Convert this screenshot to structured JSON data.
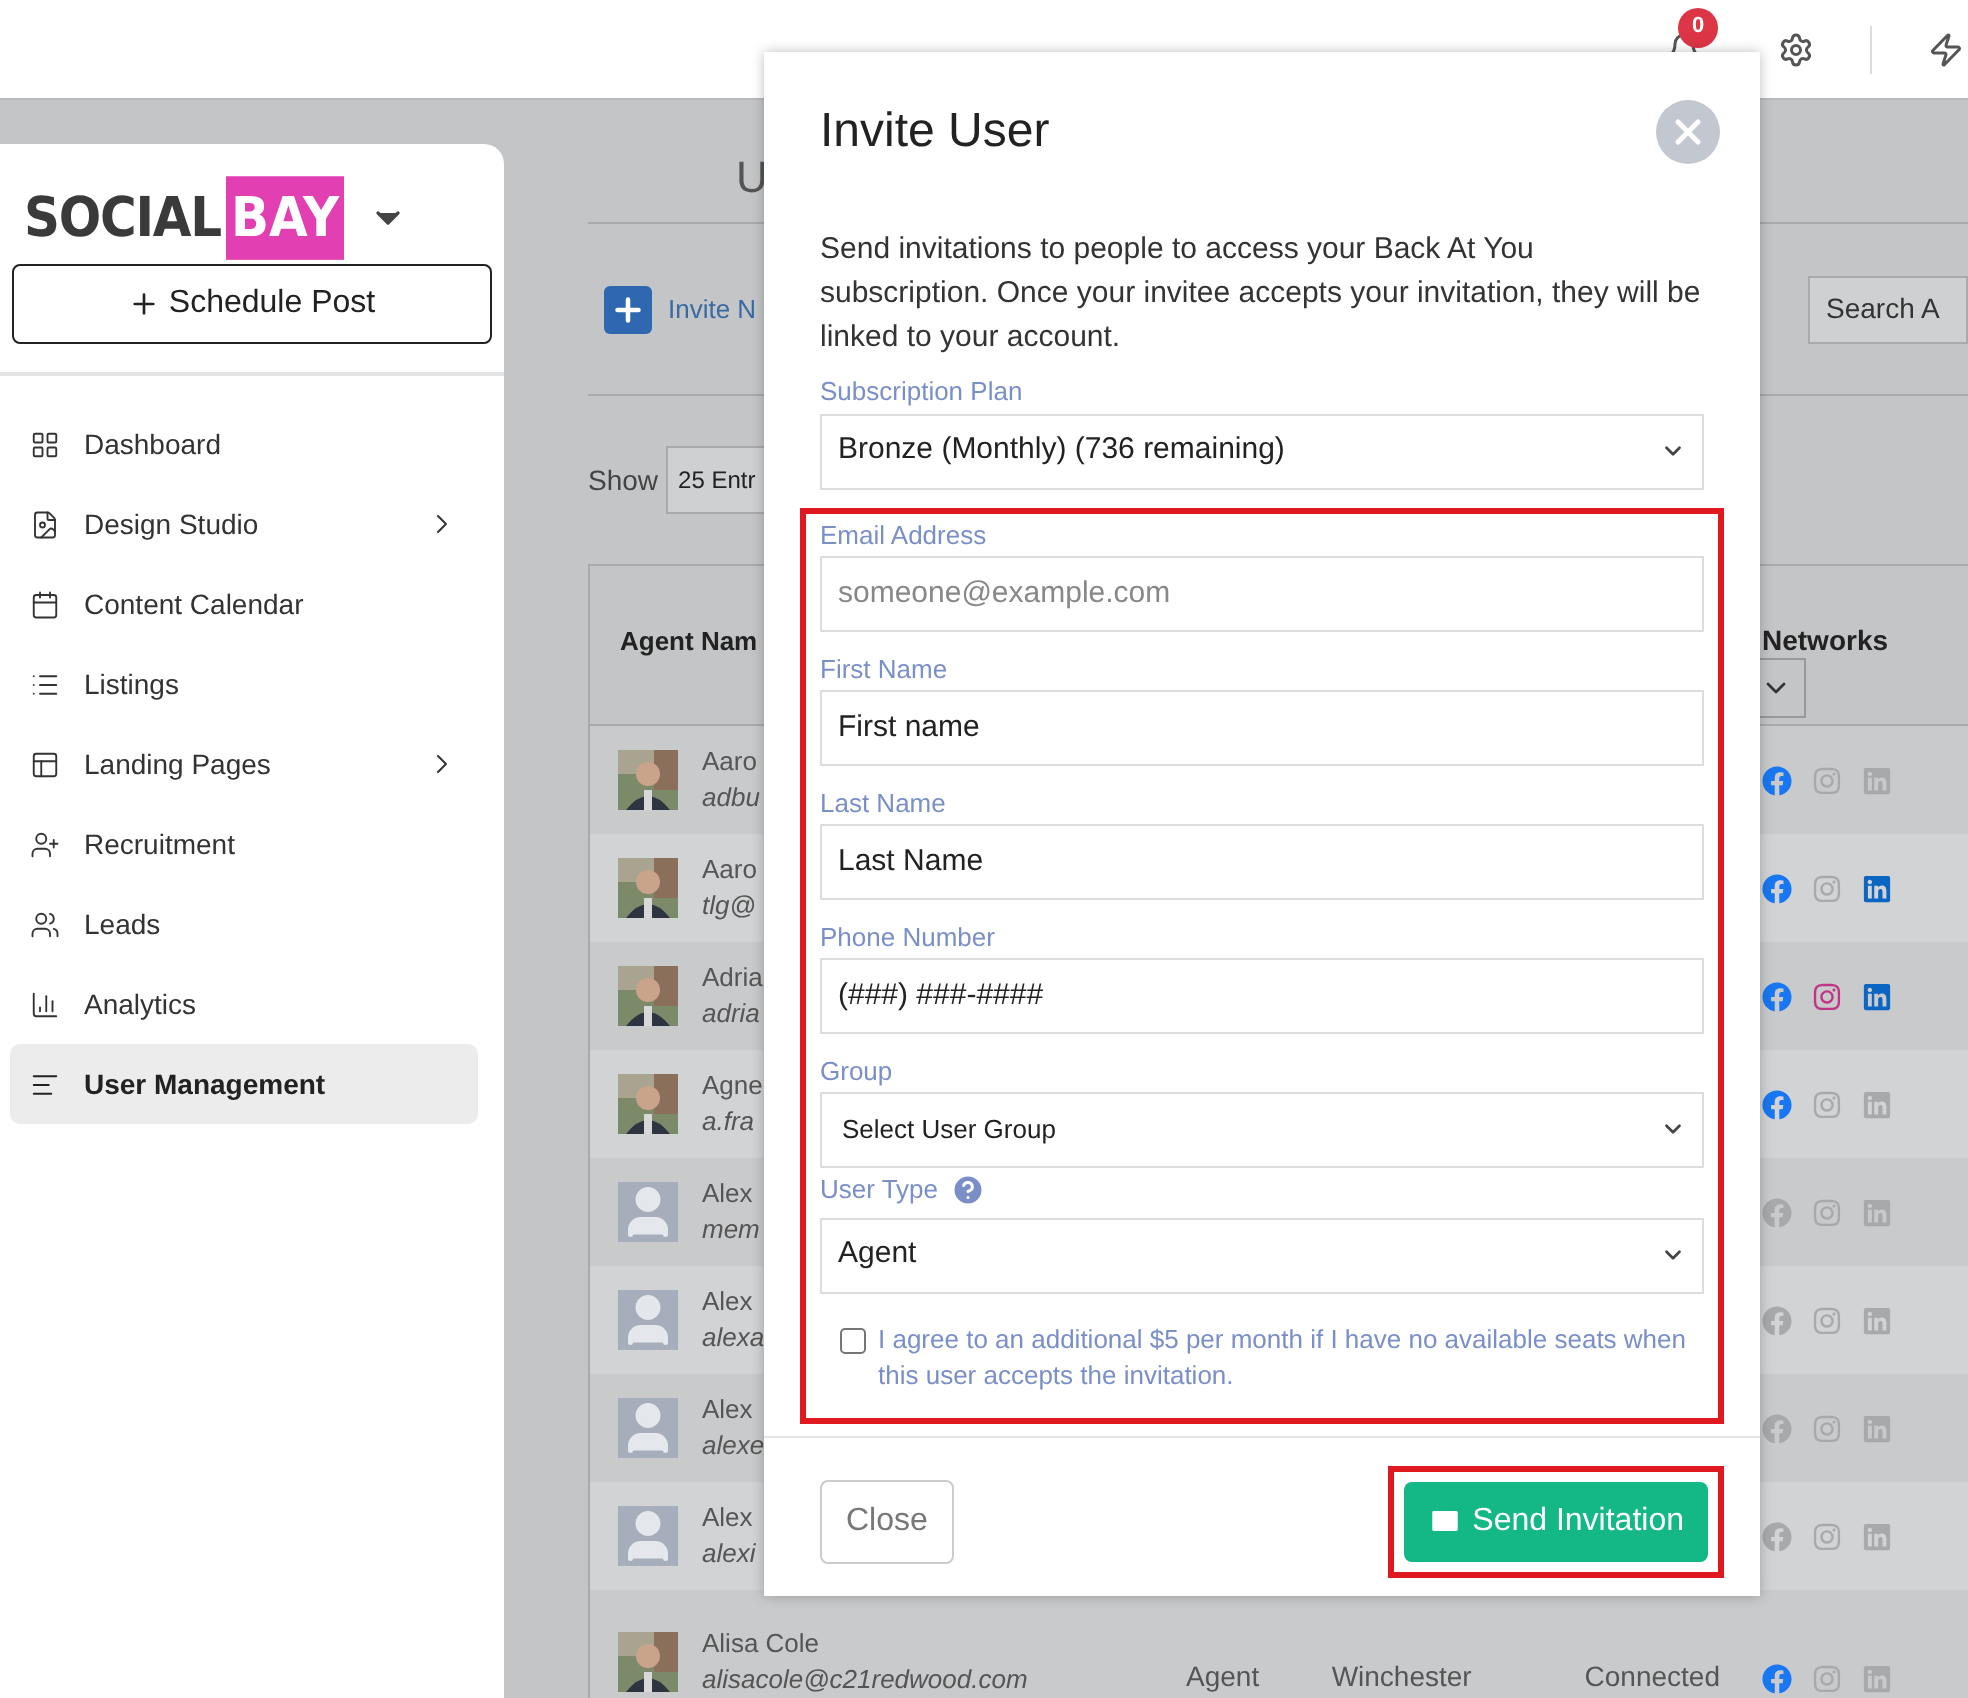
{
  "top_bar": {
    "notification_count": "0"
  },
  "sidebar": {
    "logo": {
      "word": "SOCIAL",
      "highlight": "BAY"
    },
    "schedule_button": "Schedule Post",
    "items": [
      {
        "label": "Dashboard",
        "has_submenu": false,
        "selected": false
      },
      {
        "label": "Design Studio",
        "has_submenu": true,
        "selected": false
      },
      {
        "label": "Content Calendar",
        "has_submenu": false,
        "selected": false
      },
      {
        "label": "Listings",
        "has_submenu": false,
        "selected": false
      },
      {
        "label": "Landing Pages",
        "has_submenu": true,
        "selected": false
      },
      {
        "label": "Recruitment",
        "has_submenu": false,
        "selected": false
      },
      {
        "label": "Leads",
        "has_submenu": false,
        "selected": false
      },
      {
        "label": "Analytics",
        "has_submenu": false,
        "selected": false
      },
      {
        "label": "User Management",
        "has_submenu": false,
        "selected": true
      }
    ]
  },
  "page": {
    "title": "U",
    "invite_button": "Invite N",
    "show_label": "Show",
    "entries_select": "25 Entr",
    "search_placeholder": "Search A"
  },
  "table": {
    "columns": [
      "Agent Nam",
      "Networks"
    ],
    "rows": [
      {
        "name": "Aaro",
        "email": "adbu",
        "networks": {
          "facebook": true,
          "instagram": false,
          "linkedin": false
        }
      },
      {
        "name": "Aaro",
        "email": "tlg@",
        "networks": {
          "facebook": true,
          "instagram": false,
          "linkedin": true
        }
      },
      {
        "name": "Adria",
        "email": "adria",
        "networks": {
          "facebook": true,
          "instagram": true,
          "linkedin": true
        }
      },
      {
        "name": "Agne",
        "email": "a.fra",
        "networks": {
          "facebook": true,
          "instagram": false,
          "linkedin": false
        }
      },
      {
        "kind": "placeholder",
        "name": "Alex",
        "email": "mem",
        "networks": {
          "facebook": false,
          "instagram": false,
          "linkedin": false
        }
      },
      {
        "kind": "placeholder",
        "name": "Alex",
        "email": "alexa",
        "networks": {
          "facebook": false,
          "instagram": false,
          "linkedin": false
        }
      },
      {
        "kind": "placeholder",
        "name": "Alex",
        "email": "alexe",
        "networks": {
          "facebook": false,
          "instagram": false,
          "linkedin": false
        }
      },
      {
        "kind": "placeholder",
        "name": "Alex",
        "email": "alexi",
        "networks": {
          "facebook": false,
          "instagram": false,
          "linkedin": false
        }
      },
      {
        "name": "Alisa Cole",
        "email": "alisacole@c21redwood.com",
        "role": "Agent",
        "office": "Winchester",
        "status": "Connected",
        "networks": {
          "facebook": true,
          "instagram": false,
          "linkedin": false
        }
      }
    ]
  },
  "modal": {
    "title": "Invite User",
    "intro": "Send invitations to people to access your Back At You subscription. Once your invitee accepts your invitation, they will be linked to your account.",
    "subscription": {
      "label": "Subscription Plan",
      "value": "Bronze (Monthly) (736 remaining)"
    },
    "fields": [
      {
        "kind": "input",
        "label": "Email Address",
        "placeholder": "someone@example.com"
      },
      {
        "kind": "input",
        "label": "First Name",
        "value": "First name"
      },
      {
        "kind": "input",
        "label": "Last Name",
        "value": "Last Name"
      },
      {
        "kind": "input",
        "label": "Phone Number",
        "value": "(###) ###-####"
      },
      {
        "kind": "select",
        "label": "Group",
        "value": "Select User Group",
        "small": true
      },
      {
        "kind": "select",
        "label": "User Type",
        "value": "Agent",
        "help": true
      }
    ],
    "agree": {
      "checked": false,
      "label": "I agree to an additional $5 per month if I have no available seats when this user accepts the invitation."
    },
    "close_button": "Close",
    "send_button": "Send Invitation"
  }
}
